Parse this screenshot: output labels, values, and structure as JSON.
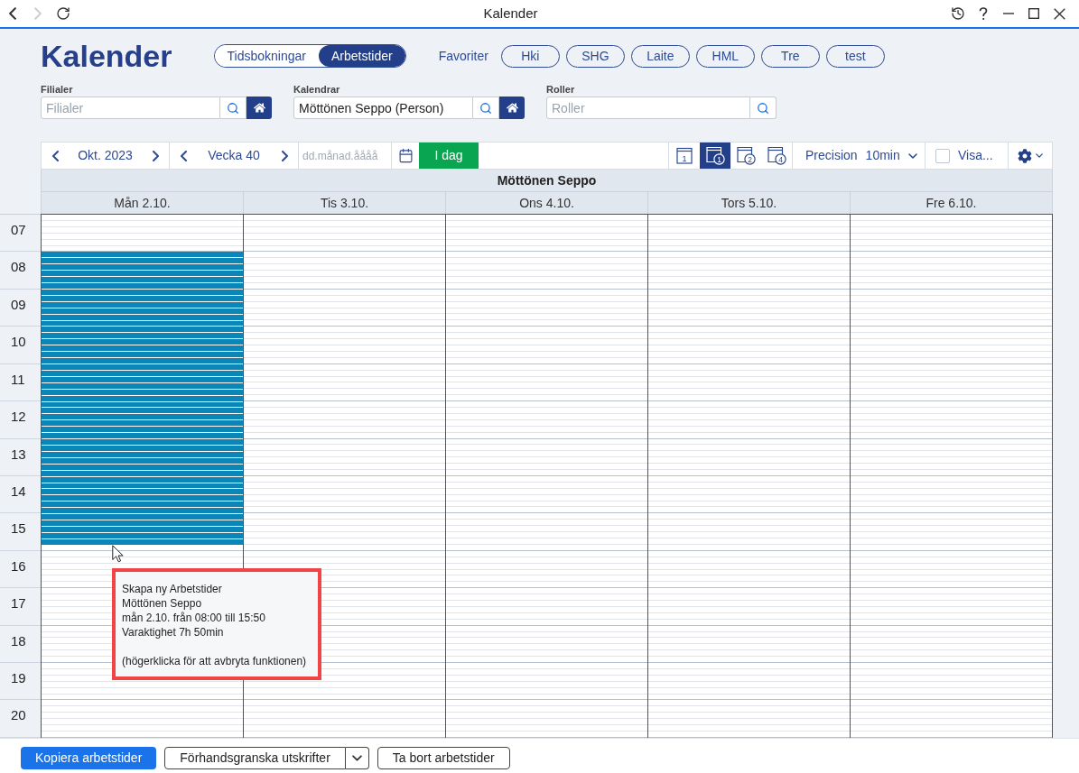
{
  "window": {
    "title": "Kalender"
  },
  "navigation": [
    {
      "kind": "back",
      "disabled": false
    },
    {
      "kind": "forward",
      "disabled": true
    },
    {
      "kind": "reload",
      "disabled": false
    }
  ],
  "page_title": "Kalender",
  "mode_switch": [
    {
      "label": "Tidsbokningar",
      "selected": false
    },
    {
      "label": "Arbetstider",
      "selected": true
    }
  ],
  "favorites": {
    "label": "Favoriter",
    "items": [
      "Hki",
      "SHG",
      "Laite",
      "HML",
      "Tre",
      "test"
    ]
  },
  "filters": [
    {
      "label": "Filialer",
      "placeholder": "Filialer",
      "home_button": true
    },
    {
      "label": "Kalendrar",
      "value": "Möttönen Seppo (Person)",
      "home_button": true
    },
    {
      "label": "Roller",
      "placeholder": "Roller",
      "home_button": false
    }
  ],
  "toolbar": {
    "month": "Okt. 2023",
    "week": "Vecka 40",
    "date_placeholder": "dd.månad.åååå",
    "today_button": "I dag",
    "views": [
      {
        "kind": "page",
        "number": "1",
        "selected": false
      },
      {
        "kind": "badge",
        "number": "1",
        "selected": true
      },
      {
        "kind": "badge",
        "number": "2",
        "selected": false
      },
      {
        "kind": "badge",
        "number": "4",
        "selected": false
      }
    ],
    "precision": {
      "label": "Precision",
      "value": "10min"
    },
    "show_option": {
      "label": "Visa...",
      "checked": false
    }
  },
  "calendar": {
    "resource": "Möttönen Seppo",
    "hours": [
      "07",
      "08",
      "09",
      "10",
      "11",
      "12",
      "13",
      "14",
      "15",
      "16",
      "17",
      "18",
      "19",
      "20"
    ],
    "days": [
      {
        "label": "Mån 2.10.",
        "has_selection": true
      },
      {
        "label": "Tis 3.10.",
        "has_selection": false
      },
      {
        "label": "Ons 4.10.",
        "has_selection": false
      },
      {
        "label": "Tors 5.10.",
        "has_selection": false
      },
      {
        "label": "Fre 6.10.",
        "has_selection": false
      }
    ]
  },
  "tooltip": {
    "title": "Skapa ny Arbetstider",
    "resource": "Möttönen Seppo",
    "range": {
      "day": "mån 2.10.",
      "from": "från",
      "start": "08:00",
      "to": "till",
      "end": "15:50"
    },
    "duration": "Varaktighet 7h 50min",
    "hint": "(högerklicka för att avbryta funktionen)"
  },
  "footer_buttons": [
    {
      "label": "Kopiera arbetstider",
      "kind": "primary"
    },
    {
      "label": "Förhandsgranska utskrifter",
      "kind": "split"
    },
    {
      "label": "Ta bort arbetstider",
      "kind": "outline"
    }
  ]
}
